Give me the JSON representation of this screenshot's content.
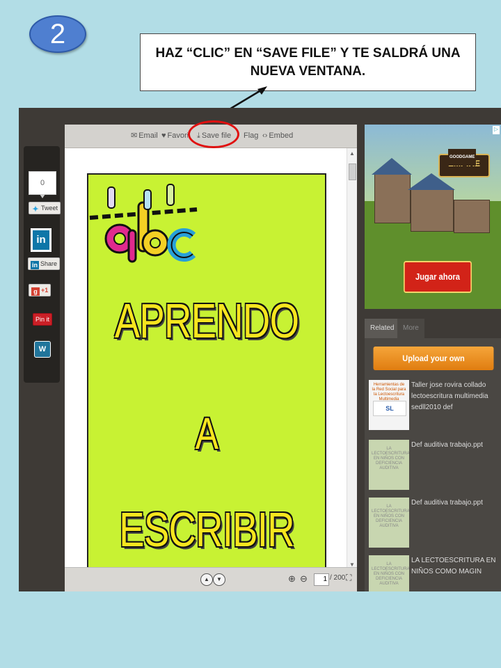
{
  "step": {
    "number": "2"
  },
  "instruction": {
    "text": "HAZ “CLIC” EN “SAVE FILE” Y TE SALDRÁ UNA NUEVA VENTANA."
  },
  "share_bar": {
    "count": "0",
    "tweet": "Tweet",
    "linkedin_share": "Share",
    "gplus": "+1",
    "pinit": "Pin it"
  },
  "toolbar": {
    "email": "Email",
    "favorite": "Favorite",
    "save_file": "Save file",
    "flag": "Flag",
    "embed": "Embed"
  },
  "document": {
    "title_lines": [
      "APRENDO",
      "A",
      "ESCRIBIR"
    ],
    "illustration": "abc"
  },
  "footer": {
    "current_page": "1",
    "total_pages": "/ 200"
  },
  "ad": {
    "logo_top": "GOODGAME",
    "logo": "EMPIRE",
    "cta": "Jugar ahora"
  },
  "tabs": [
    "Related",
    "More"
  ],
  "related": {
    "upload_label": "Upload your own",
    "items": [
      {
        "title": "Taller jose rovira collado lectoescritura multimedia sedll2010 def",
        "thumb_text": "Herramientas de la Red Social para la Lectoescritura Multimedia"
      },
      {
        "title": "Def auditiva trabajo.ppt",
        "thumb_text": "LA LECTOESCRITURA EN NIÑOS CON DEFICIENCIA AUDITIVA"
      },
      {
        "title": "Def auditiva trabajo.ppt",
        "thumb_text": "LA LECTOESCRITURA EN NIÑOS CON DEFICIENCIA AUDITIVA"
      },
      {
        "title": "LA LECTOESCRITURA EN NIÑOS COMO MAGIN",
        "thumb_text": "LA LECTOESCRITURA EN NIÑOS CON DEFICIENCIA AUDITIVA"
      }
    ]
  },
  "colors": {
    "background": "#b2dde6",
    "badge": "#4f7fd0",
    "highlight_ring": "#e01010",
    "page": "#c8f233",
    "title_text": "#f6e51e",
    "upload": "#e07d10"
  }
}
